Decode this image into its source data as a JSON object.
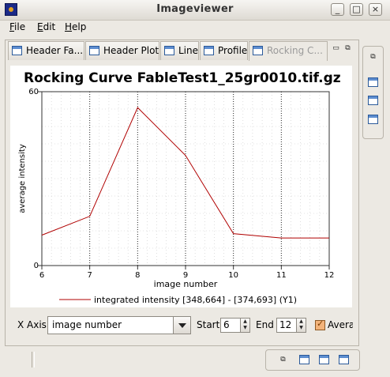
{
  "window": {
    "title": "Imageviewer",
    "buttons": {
      "minimize": "_",
      "maximize": "□",
      "close": "×"
    }
  },
  "menu": {
    "items": [
      {
        "mnemonic": "F",
        "rest": "ile"
      },
      {
        "mnemonic": "E",
        "rest": "dit"
      },
      {
        "mnemonic": "H",
        "rest": "elp"
      }
    ]
  },
  "tabs": [
    {
      "label": "Header Fa..."
    },
    {
      "label": "Header Plot"
    },
    {
      "label": "Line"
    },
    {
      "label": "Profile"
    },
    {
      "label": "Rocking C..."
    }
  ],
  "chart_data": {
    "type": "line",
    "title": "Rocking Curve FableTest1_25gr0010.tif.gz",
    "xlabel": "image number",
    "ylabel": "average intensity",
    "xlim": [
      6,
      12
    ],
    "ylim": [
      0,
      60
    ],
    "x_ticks": [
      "6",
      "7",
      "8",
      "9",
      "10",
      "11",
      "12"
    ],
    "y_ticks": [
      "0",
      "60"
    ],
    "grid": true,
    "legend": "bottom",
    "series": [
      {
        "name": "integrated intensity [348,664] - [374,693] (Y1)",
        "color": "#b00000",
        "x": [
          6,
          7,
          8,
          9,
          10,
          11,
          12
        ],
        "y": [
          10.5,
          17,
          54.5,
          38,
          11,
          9.5,
          9.5
        ]
      }
    ]
  },
  "controls": {
    "xaxis_label": "X Axis",
    "xaxis_value": "image number",
    "start_label": "Start",
    "start_value": "6",
    "end_label": "End",
    "end_value": "12",
    "average_label": "Avera"
  },
  "colors": {
    "accent_icon": "#2b5a9a",
    "checkbox": "#f3b37a",
    "series_line": "#b00000"
  }
}
